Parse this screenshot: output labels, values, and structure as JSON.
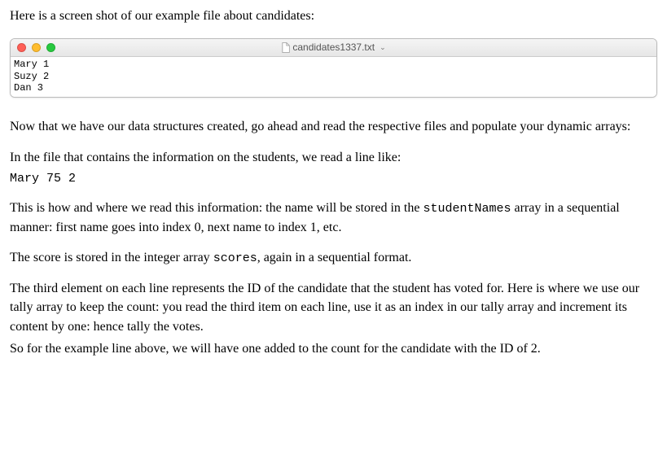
{
  "intro": "Here is a screen shot of our example file about candidates:",
  "editor": {
    "filename": "candidates1337.txt",
    "lines": [
      "Mary 1",
      "Suzy 2",
      "Dan 3"
    ]
  },
  "paragraphs": {
    "p1": "Now that we have our data structures created, go ahead and read the respective files and populate your dynamic arrays:",
    "p2": "In the file that contains the information on the students, we read a line like:",
    "codeLine": "Mary 75 2",
    "p3a": "This is how and where we read this information: the name will be stored in the ",
    "p3code": "studentNames",
    "p3b": " array in a sequential manner: first name goes into index 0, next name to index 1, etc.",
    "p4a": "The score is stored in the integer array ",
    "p4code": "scores",
    "p4b": ", again in a sequential format.",
    "p5": "The third element on each line represents the ID of the candidate that the student has voted for. Here is where we use our tally array to keep the count: you read the third item on each line, use it as an index in our tally array and increment its content by one: hence tally the votes.",
    "p6": "So for the example line above, we will have one added to the count for the candidate with the ID of 2."
  }
}
